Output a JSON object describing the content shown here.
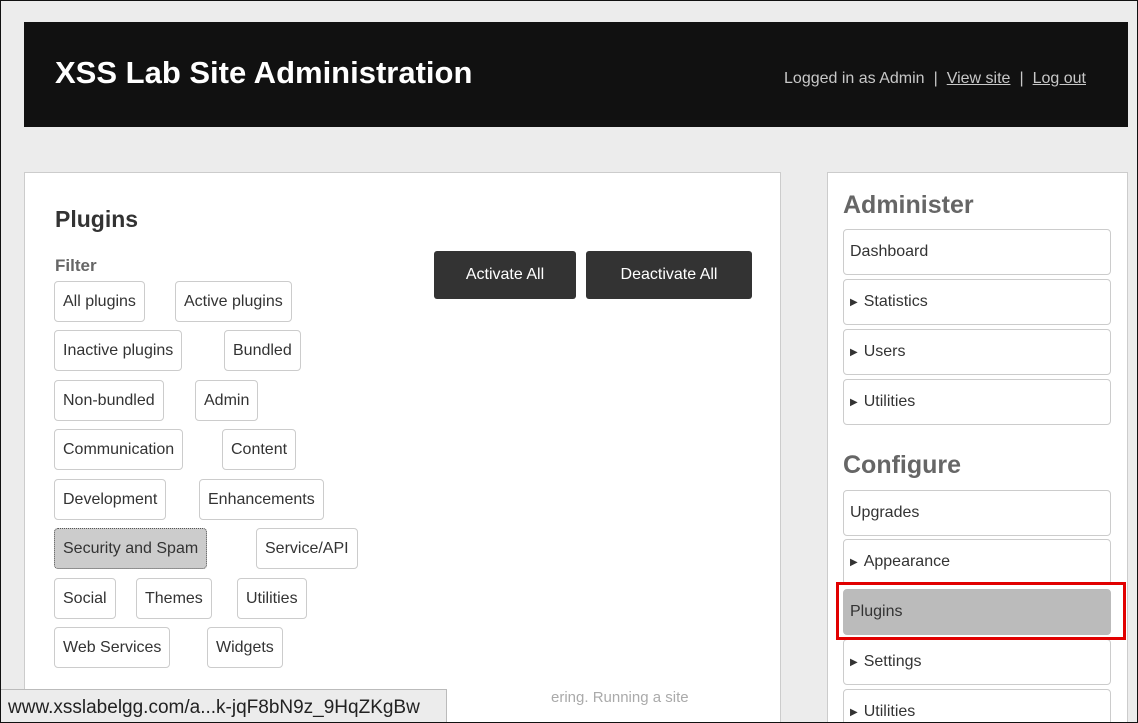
{
  "header": {
    "site_title": "XSS Lab Site Administration",
    "logged_in_text": "Logged in as Admin",
    "separator": "|",
    "view_site": "View site",
    "log_out": "Log out"
  },
  "main": {
    "title": "Plugins",
    "filter_label": "Filter",
    "filters": [
      "All plugins",
      "Active plugins",
      "Inactive plugins",
      "Bundled",
      "Non-bundled",
      "Admin",
      "Communication",
      "Content",
      "Development",
      "Enhancements",
      "Security and Spam",
      "Service/API",
      "Social",
      "Themes",
      "Utilities",
      "Web Services",
      "Widgets"
    ],
    "selected_filter": "Security and Spam",
    "activate_all": "Activate All",
    "deactivate_all": "Deactivate All",
    "partial_notice": "ering. Running a site"
  },
  "sidebar": {
    "administer_heading": "Administer",
    "administer_items": [
      "Dashboard",
      "Statistics",
      "Users",
      "Utilities"
    ],
    "configure_heading": "Configure",
    "configure_items": [
      "Upgrades",
      "Appearance",
      "Plugins",
      "Settings",
      "Utilities"
    ],
    "arrow_glyph": "▶",
    "active_item": "Plugins"
  },
  "status_bar": {
    "url": "www.xsslabelgg.com/a...k-jqF8bN9z_9HqZKgBw"
  },
  "colors": {
    "header_bg": "#111111",
    "highlight": "#e10000",
    "button_dark": "#333333"
  }
}
